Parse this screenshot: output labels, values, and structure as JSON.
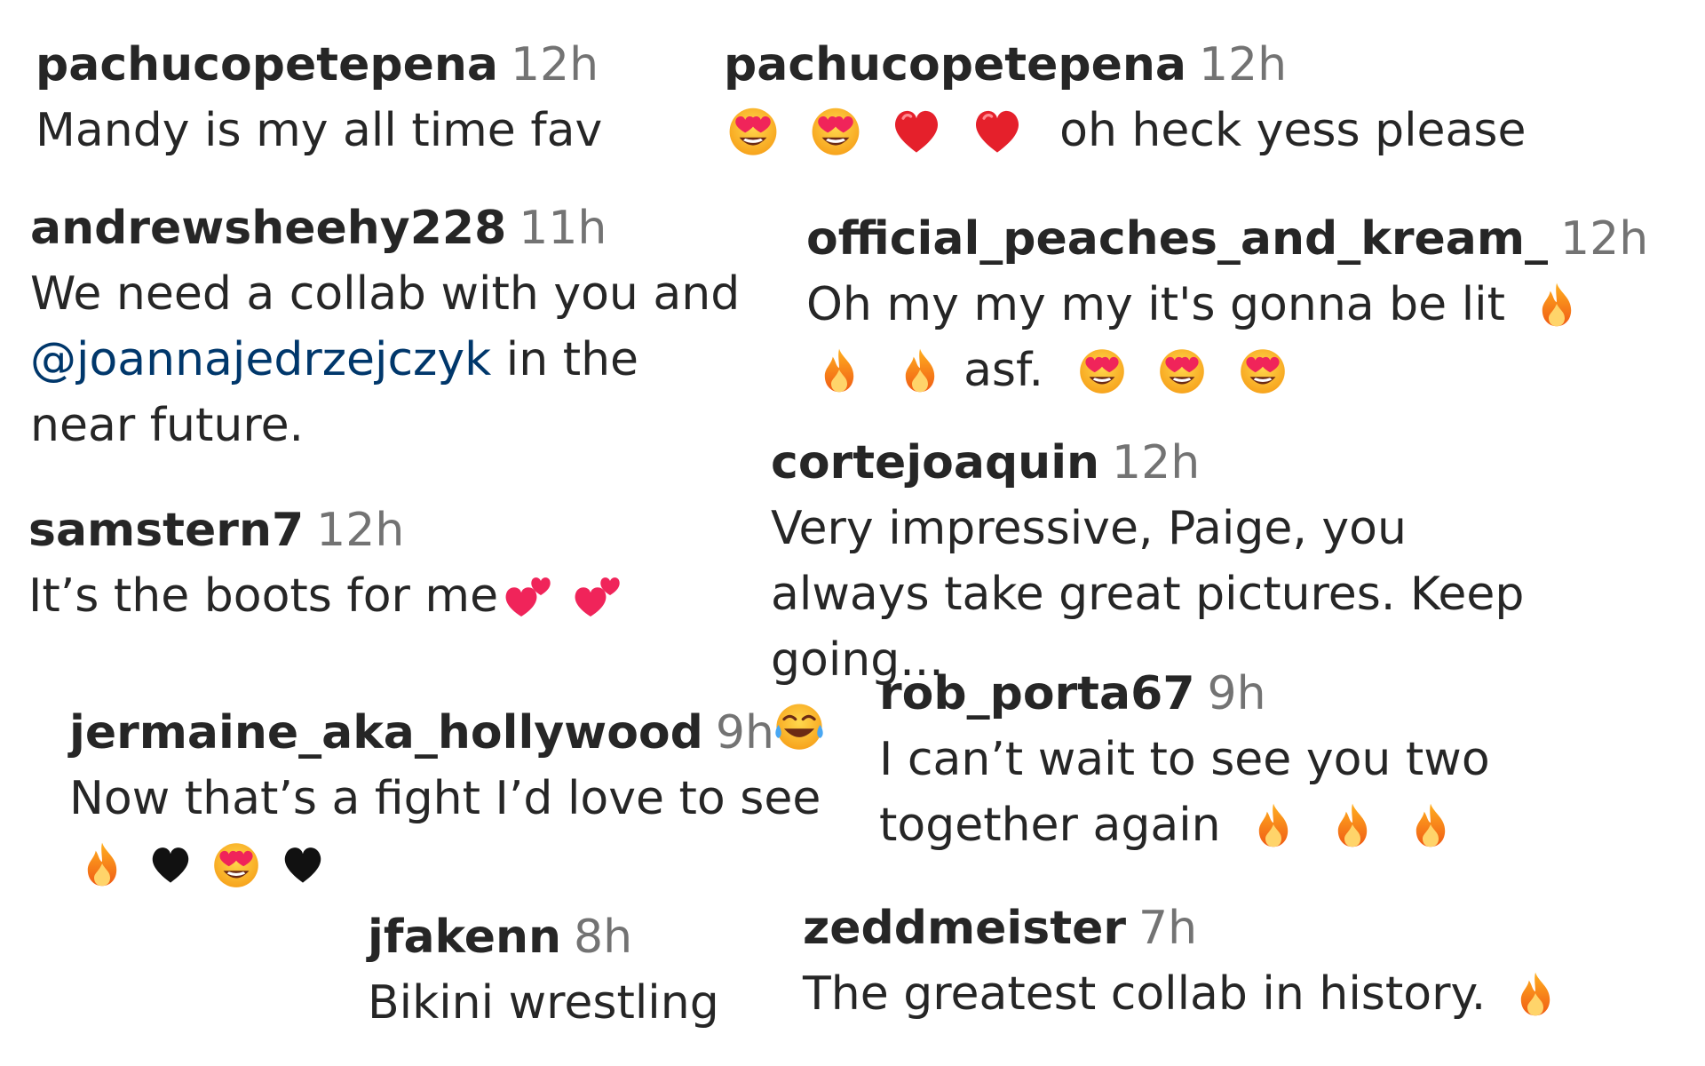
{
  "comments": [
    {
      "user": "pachucopetepena",
      "time": "12h",
      "text": "Mandy is my all time fav"
    },
    {
      "user": "pachucopetepena",
      "time": "12h",
      "text": "oh heck yess please",
      "emoji": [
        "heart-eyes-icon",
        "heart-eyes-icon",
        "red-heart-icon",
        "red-heart-icon"
      ]
    },
    {
      "user": "andrewsheehy228",
      "time": "11h",
      "text_before": "We need a collab with you and",
      "mention": "@joannajedrzejczyk",
      "text_after": "in the near future."
    },
    {
      "user": "official_peaches_and_kream_",
      "time": "12h",
      "text": "Oh my my my it's gonna be lit",
      "text_mid": "asf."
    },
    {
      "user": "cortejoaquin",
      "time": "12h",
      "text": "Very impressive, Paige, you always take great pictures. Keep going..."
    },
    {
      "user": "samstern7",
      "time": "12h",
      "text": "It’s the boots for me"
    },
    {
      "user": "rob_porta67",
      "time": "9h",
      "text": "I can’t wait to see you two together again"
    },
    {
      "user": "jermaine_aka_hollywood",
      "time": "9h",
      "text": "Now that’s a fight I’d love to see"
    },
    {
      "user": "jfakenn",
      "time": "8h",
      "text": "Bikini wrestling"
    },
    {
      "user": "zeddmeister",
      "time": "7h",
      "text": "The greatest collab in history."
    }
  ],
  "colors": {
    "username": "#262626",
    "timestamp": "#737373",
    "mention": "#00376b",
    "body": "#262626"
  }
}
